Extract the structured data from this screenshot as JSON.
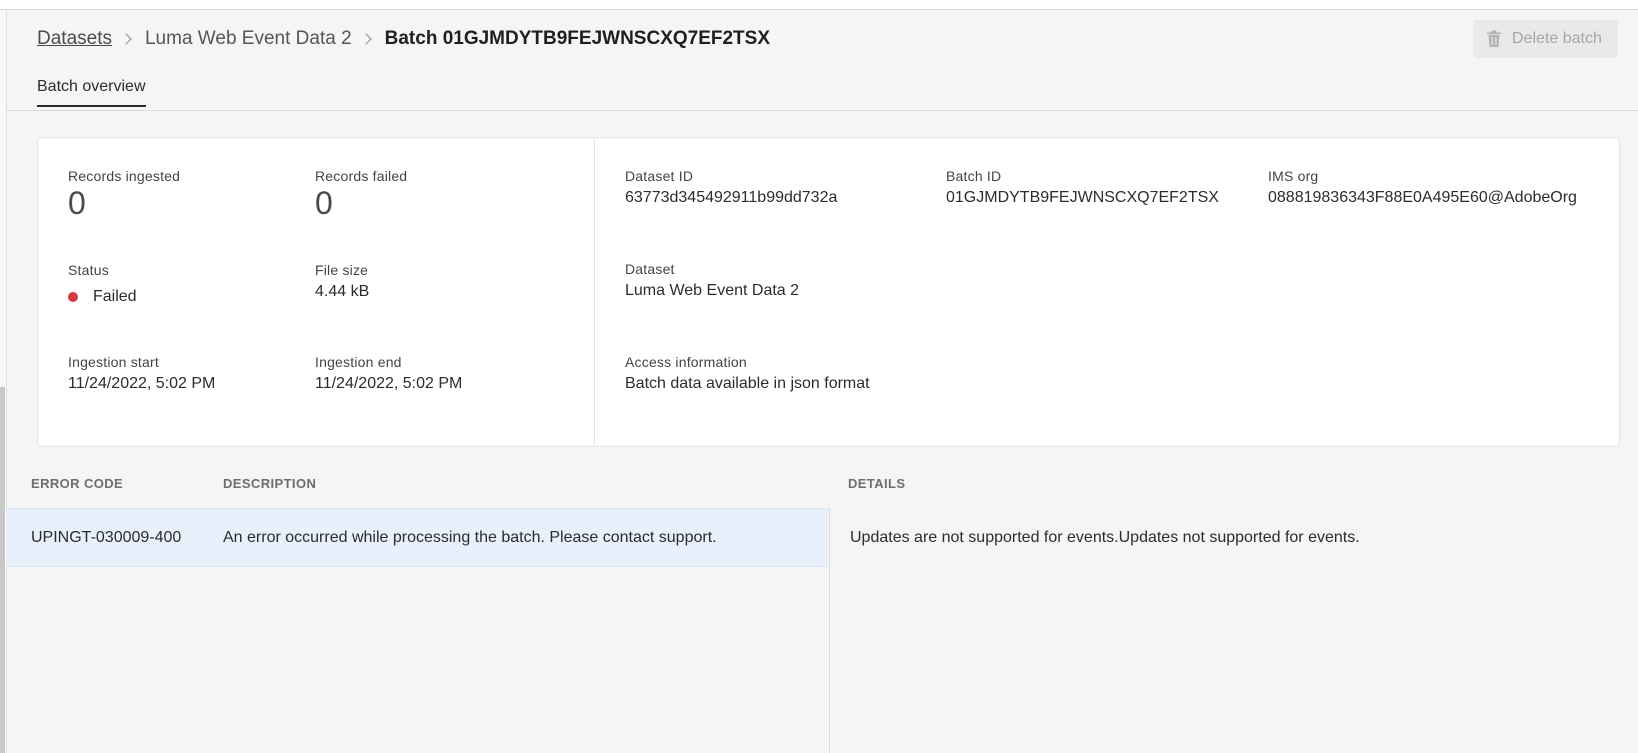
{
  "breadcrumb": {
    "root": "Datasets",
    "dataset": "Luma Web Event Data 2",
    "current": "Batch 01GJMDYTB9FEJWNSCXQ7EF2TSX"
  },
  "actions": {
    "delete_label": "Delete batch"
  },
  "tabs": [
    {
      "label": "Batch overview",
      "active": true
    }
  ],
  "summary": {
    "records_ingested": {
      "label": "Records ingested",
      "value": "0"
    },
    "records_failed": {
      "label": "Records failed",
      "value": "0"
    },
    "status": {
      "label": "Status",
      "value": "Failed",
      "color": "#d7373f"
    },
    "file_size": {
      "label": "File size",
      "value": "4.44 kB"
    },
    "ingestion_start": {
      "label": "Ingestion start",
      "value": "11/24/2022, 5:02 PM"
    },
    "ingestion_end": {
      "label": "Ingestion end",
      "value": "11/24/2022, 5:02 PM"
    }
  },
  "details": {
    "dataset_id": {
      "label": "Dataset ID",
      "value": "63773d345492911b99dd732a"
    },
    "batch_id": {
      "label": "Batch ID",
      "value": "01GJMDYTB9FEJWNSCXQ7EF2TSX"
    },
    "ims_org": {
      "label": "IMS org",
      "value": "088819836343F88E0A495E60@AdobeOrg"
    },
    "dataset": {
      "label": "Dataset",
      "value": "Luma Web Event Data 2"
    },
    "access": {
      "label": "Access information",
      "value": "Batch data available in json format"
    }
  },
  "errors": {
    "columns": [
      "ERROR CODE",
      "DESCRIPTION"
    ],
    "details_header": "DETAILS",
    "rows": [
      {
        "code": "UPINGT-030009-400",
        "description": "An error occurred while processing the batch. Please contact support."
      }
    ],
    "details_text": "Updates are not supported for events.Updates not supported for events."
  }
}
